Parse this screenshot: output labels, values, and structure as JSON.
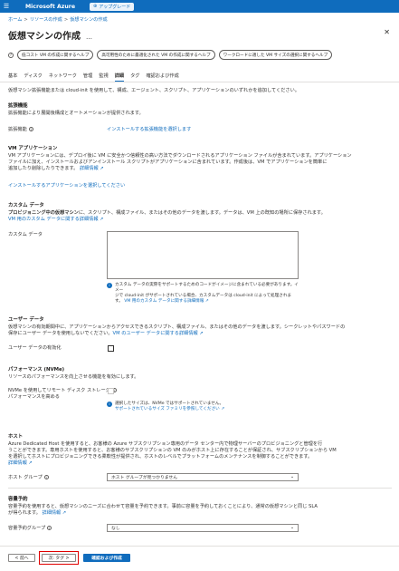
{
  "topbar": {
    "brand": "Microsoft Azure",
    "upgrade": "アップグレード"
  },
  "breadcrumb": [
    "ホーム",
    "リソースの作成",
    "仮想マシンの作成"
  ],
  "page": {
    "title": "仮想マシンの作成",
    "more": "…",
    "close": "✕"
  },
  "quick_buttons": [
    "低コスト VM の作成に関するヘルプ",
    "高可用性のために最適化された VM の作成に関するヘルプ",
    "ワークロードに適した VM サイズの選択に関するヘルプ"
  ],
  "tabs": [
    "基本",
    "ディスク",
    "ネットワーク",
    "管理",
    "監視",
    "詳細",
    "タグ",
    "確認および作成"
  ],
  "active_tab": "詳細",
  "intro": "仮想マシン拡張機能または cloud-init を使用して、構成、エージェント、スクリプト、アプリケーションのいずれかを追加してください。",
  "extensions": {
    "heading": "拡張機能",
    "desc": "拡張機能により展開後構成とオートメーションが提供されます。",
    "label": "拡張機能",
    "link": "インストールする拡張機能を選択します"
  },
  "vm_apps": {
    "heading": "VM アプリケーション",
    "desc1": "VM アプリケーションには、デプロイ後に VM に安全かつ信頼性の高い方法でダウンロードされるアプリケーション ファイルが含まれています。アプリケーション",
    "desc2": "ファイルに加え、インストールおよびアンインストール スクリプトがアプリケーションに含まれています。作成後は、VM でアプリケーションを簡単に",
    "desc3": "追加したり削除したりできます。",
    "desc_link": "詳細情報",
    "link": "インストールするアプリケーションを選択してください"
  },
  "custom_data": {
    "heading": "カスタム データ",
    "desc_bold": "プロビジョニング中の仮想マシン",
    "desc": "に、スクリプト、構成ファイル、またはその他のデータを渡します。データは、VM 上の既知の場所に保存されます。",
    "link": "VM 用のカスタム データに関する詳細情報",
    "label": "カスタム データ",
    "info1": "カスタム データの実際をサポートするためのコードがイメージに含まれている必要があります。イメー",
    "info2": "ジで cloud-init がサポートされている場合、カスタムデータは cloud-init によって処理されま",
    "info3": "す。",
    "info_link": "VM 用のカスタム データに関する詳細情報"
  },
  "user_data": {
    "heading": "ユーザー データ",
    "desc1": "仮想マシンの有効期間中に、アプリケーションからアクセスできるスクリプト、構成ファイル、またはその他のデータを渡します。シークレットやパスワードの",
    "desc2": "保存にユーザー データを使用しないでください。",
    "link": "VM のユーザー データに関する詳細情報",
    "label": "ユーザー データの有効化"
  },
  "nvme": {
    "heading": "パフォーマンス (NVMe)",
    "desc": "リソースのパフォーマンスを向上させる機能を有効にします。",
    "label1": "NVMe を使用してリモート ディスク ストレージ",
    "label2": "パフォーマンスを高める",
    "info1": "選択したサイズは、NVMe ではサポートされていません。",
    "info_link": "サポートされているサイズ ファミリを参照してください"
  },
  "host": {
    "heading": "ホスト",
    "desc1": "Azure Dedicated Host を使用すると、お客様の Azure サブスクリプション専用のデータ センター内で物理サーバーのプロビジョニングと管理を行",
    "desc2": "うことができます。専用ホストを使用すると、お客様のサブスクリプションの VM のみがホスト上に存在することが保証され、サブスクリプションから VM",
    "desc3": "を選択してホストにプロビジョニングできる柔軟性が提供され、ホストのレベルでプラットフォームのメンテナンスを制御することができます。",
    "link": "詳細情報",
    "label": "ホスト グループ",
    "value": "ホスト グループが見つかりません"
  },
  "capacity": {
    "heading": "容量予約",
    "desc1": "容量予約を使用すると、仮想マシンのニーズに合わせて容量を予約できます。事前に容量を予約しておくことにより、通常の仮想マシンと同じ SLA",
    "desc2": "が得られます。",
    "link": "詳細情報",
    "label": "容量予約グループ",
    "value": "なし"
  },
  "footer": {
    "prev": "< 前へ",
    "next": "次: タグ >",
    "create": "確認および作成"
  },
  "colors": {
    "accent": "#0f6cbd",
    "highlight": "#e00000"
  }
}
